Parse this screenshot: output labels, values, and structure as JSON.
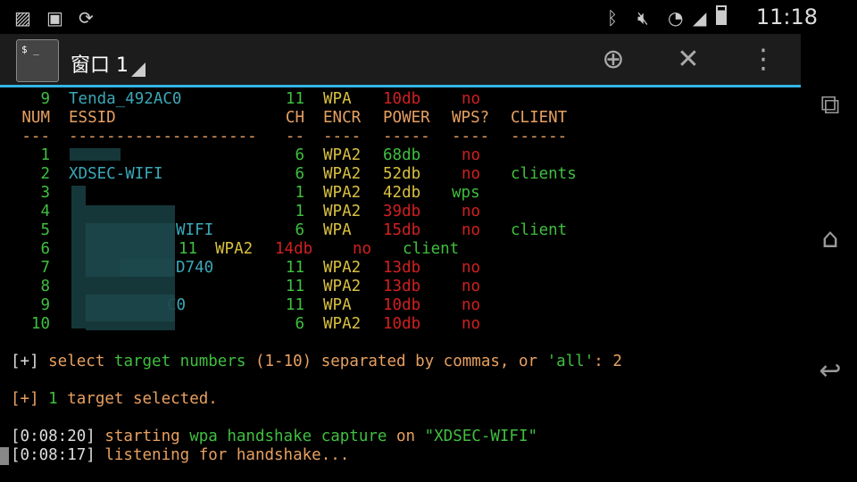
{
  "status_bar": {
    "time": "11:18",
    "icons": [
      "image-icon",
      "terminal-icon",
      "sync-icon",
      "bluetooth-icon",
      "mute-icon",
      "wifi-icon",
      "signal-icon",
      "battery-icon"
    ]
  },
  "action_bar": {
    "title": "窗口 1",
    "app_icon_text": "$ _",
    "actions": [
      "add-icon",
      "close-icon",
      "overflow-menu-icon"
    ]
  },
  "nav_bar": [
    "recents-icon",
    "home-icon",
    "back-icon"
  ],
  "terminal": {
    "prev_row": {
      "num": "9",
      "essid": "Tenda_492AC0",
      "ch": "11",
      "encr": "WPA",
      "power": "10db",
      "wps": "no",
      "client": ""
    },
    "headers": {
      "num": "NUM",
      "essid": "ESSID",
      "ch": "CH",
      "encr": "ENCR",
      "power": "POWER",
      "wps": "WPS?",
      "client": "CLIENT"
    },
    "separators": {
      "num": "---",
      "essid": "--------------------",
      "ch": "--",
      "encr": "----",
      "power": "-----",
      "wps": "----",
      "client": "------"
    },
    "rows": [
      {
        "num": "1",
        "essid": "",
        "ch": "6",
        "encr": "WPA2",
        "power": "68db",
        "power_color": "g",
        "wps": "no",
        "client": ""
      },
      {
        "num": "2",
        "essid": "XDSEC-WIFI",
        "ch": "6",
        "encr": "WPA2",
        "power": "52db",
        "power_color": "y",
        "wps": "no",
        "client": "clients"
      },
      {
        "num": "3",
        "essid": "",
        "ch": "1",
        "encr": "WPA2",
        "power": "42db",
        "power_color": "y",
        "wps": "wps",
        "client": ""
      },
      {
        "num": "4",
        "essid": "",
        "ch": "1",
        "encr": "WPA2",
        "power": "39db",
        "power_color": "rd",
        "wps": "no",
        "client": ""
      },
      {
        "num": "5",
        "essid": "WIFI",
        "ch": "6",
        "encr": "WPA",
        "power": "15db",
        "power_color": "rd",
        "wps": "no",
        "client": "client"
      },
      {
        "num": "6",
        "essid": "",
        "ch": "11",
        "encr": "WPA2",
        "power": "14db",
        "power_color": "rd",
        "wps": "no",
        "client": "client",
        "shifted": true
      },
      {
        "num": "7",
        "essid": "D740",
        "ch": "11",
        "encr": "WPA2",
        "power": "13db",
        "power_color": "rd",
        "wps": "no",
        "client": ""
      },
      {
        "num": "8",
        "essid": "",
        "ch": "11",
        "encr": "WPA2",
        "power": "13db",
        "power_color": "rd",
        "wps": "no",
        "client": ""
      },
      {
        "num": "9",
        "essid": "C0",
        "ch": "11",
        "encr": "WPA",
        "power": "10db",
        "power_color": "rd",
        "wps": "no",
        "client": ""
      },
      {
        "num": "10",
        "essid": "",
        "ch": "6",
        "encr": "WPA2",
        "power": "10db",
        "power_color": "rd",
        "wps": "no",
        "client": ""
      }
    ],
    "prompt": {
      "prefix": "[+]",
      "p1": " select ",
      "p2": "target numbers",
      "p3": " (1-10) separated by commas, or ",
      "p4": "'all'",
      "p5": ":",
      "input": " 2"
    },
    "selected": {
      "prefix": "[+]",
      "count": " 1",
      "text": " target selected."
    },
    "log1": {
      "time": "[0:08:20]",
      "p1": " starting ",
      "p2": "wpa handshake capture",
      "p3": " on ",
      "p4": "\"XDSEC-WIFI\""
    },
    "log2": {
      "time": "[0:08:17]",
      "text": " listening for handshake..."
    }
  }
}
